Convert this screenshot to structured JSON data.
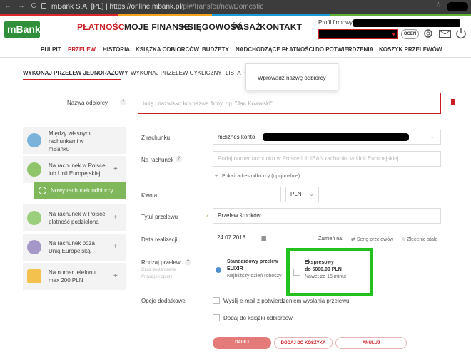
{
  "browser": {
    "site_name": "mBank S.A. [PL]",
    "url_separator": "|",
    "url_domain": "https://online.mbank.pl",
    "url_path": "/pl#/transfer/newDomestic",
    "nav_glyphs": "← → C",
    "star": "☆"
  },
  "brand": {
    "logo_text": "mBank",
    "accent": "#c81e24",
    "green": "#7fb75a",
    "highlight": "#22c11d"
  },
  "main_nav": [
    "PŁATNOŚCI",
    "MOJE FINANSE",
    "KSIĘGOWOŚĆ",
    "PASAŻ",
    "KONTAKT"
  ],
  "profile": {
    "label": "Profil firmowy",
    "dropdown_arrow": "▾",
    "button": "OCEŃ"
  },
  "sub_nav": [
    "PULPIT",
    "PRZELEW",
    "HISTORIA",
    "KSIĄŻKA ODBIORCÓW",
    "BUDŻETY",
    "NADCHODZĄCE PŁATNOŚCI",
    "DO POTWIERDZENIA",
    "KOSZYK PRZELEWÓW"
  ],
  "tabs": [
    "WYKONAJ PRZELEW JEDNORAZOWY",
    "WYKONAJ PRZELEW CYKLICZNY",
    "LISTA P"
  ],
  "tooltip": "Wprowadź nazwę odbiorcy",
  "recipient": {
    "label": "Nazwa odbiorcy",
    "placeholder": "Imię i nazwisko lub nazwa firmy, np. \"Jan Kowalski\""
  },
  "cards": [
    {
      "l1": "Między własnymi",
      "l2": "rachunkami w",
      "l3": "mBanku"
    },
    {
      "l1": "Na rachunek w Polsce",
      "l2": "lub Unii Europejskiej",
      "l3": ""
    },
    {
      "l1": "Na rachunek w Polsce",
      "l2": "płatność podzielona",
      "l3": ""
    },
    {
      "l1": "Na rachunek poza",
      "l2": "Unią Europejską",
      "l3": ""
    },
    {
      "l1": "Na numer telefonu",
      "l2": "max 200 PLN",
      "l3": ""
    }
  ],
  "new_recipient_button": "Nowy rachunek odbiorcy",
  "form": {
    "from_label": "Z rachunku",
    "from_value": "mBiznes konto",
    "to_label": "Na rachunek",
    "to_placeholder": "Podaj numer rachunku w Polsce lub IBAN rachunku w Unii Europejskiej",
    "show_address": "Pokaż adres odbiorcy (opcjonalnie)",
    "amount_label": "Kwota",
    "currency": "PLN",
    "title_label": "Tytuł przelewu",
    "title_value": "Przelew środków",
    "date_label": "Data realizacji",
    "date_value": "24.07.2018",
    "change_to": "Zamień na:",
    "series": "Serię przelewów",
    "permanent": "Zlecenie stałe",
    "type_label": "Rodzaj przelewu",
    "type_sub1": "Czas dostarczenia",
    "type_sub2": "Prowizje i opłaty",
    "standard_l1": "Standardowy przelew",
    "standard_l2": "ELIXIR",
    "standard_l3": "Najbliższy dzień roboczy",
    "express_l1": "Ekspresowy",
    "express_l2": "do 5000,00 PLN",
    "express_l3": "Nawet za 15 minut",
    "extra_label": "Opcje dodatkowe",
    "email_opt": "Wyślij e-mail z potwierdzeniem wysłania przelewu",
    "book_opt": "Dodaj do książki odbiorców"
  },
  "buttons": {
    "next": "DALEJ",
    "cart": "DODAJ DO KOSZYKA",
    "cancel": "ANULUJ"
  }
}
